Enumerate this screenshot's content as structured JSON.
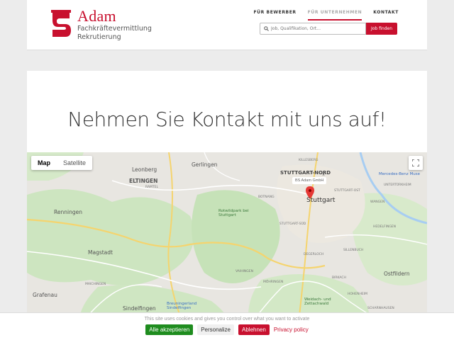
{
  "logo": {
    "name": "Adam",
    "sub1": "Fachkräftevermittlung",
    "sub2": "Rekrutierung"
  },
  "nav": {
    "items": [
      {
        "label": "FÜR BEWERBER"
      },
      {
        "label": "FÜR UNTERNEHMEN"
      },
      {
        "label": "KONTAKT"
      }
    ]
  },
  "search": {
    "placeholder": "Job, Qualifikation, Ort...",
    "button": "Job finden"
  },
  "hero": {
    "title": "Nehmen Sie Kontakt mit uns auf!"
  },
  "map": {
    "type_map": "Map",
    "type_satellite": "Satellite",
    "marker_label": "BS Adam GmbH",
    "labels": {
      "leonberg": "Leonberg",
      "eltingen": "ELTINGEN",
      "gerlingen": "Gerlingen",
      "renningen": "Renningen",
      "magstadt": "Magstadt",
      "grafenau": "Grafenau",
      "sindelfingen": "Sindelfingen",
      "stuttgart": "Stuttgart",
      "stuttgart_nord": "STUTTGART-NORD",
      "rotwildpark": "Rotwildpark bei Stuttgart",
      "mercedes": "Mercedes-Benz Muse",
      "ostfildern": "Ostfildern",
      "weidach": "Weidach- und Zettachwald",
      "breuningerland": "Breuningerland Sindelfingen",
      "killesberg": "KILLESBERG",
      "unterturkheim": "UNTERTÜRKHEIM",
      "wangen": "WANGEN",
      "vaihingen": "VAIHINGEN",
      "mohringen": "MÖHRINGEN",
      "degerloch": "DEGERLOCH",
      "sillenbuch": "SILLENBUCH",
      "birkach": "BIRKACH",
      "hohenheim": "HOHENHEIM",
      "maichingen": "MAICHINGEN",
      "hedelfingen": "HEDELFINGEN",
      "ramtel": "RAMTEL",
      "botnang": "BOTNANG",
      "stuttgart_ost": "STUTTGART-OST",
      "stuttgart_sud": "STUTTGART-SÜD",
      "scharnhausen": "SCHARNHAUSEN"
    }
  },
  "cookie": {
    "text": "This site uses cookies and gives you control over what you want to activate",
    "accept": "Alle akzeptieren",
    "personalize": "Personalize",
    "decline": "Ablehnen",
    "policy": "Privacy policy"
  },
  "colors": {
    "brand": "#c8102e",
    "accept": "#1e8c1e"
  }
}
